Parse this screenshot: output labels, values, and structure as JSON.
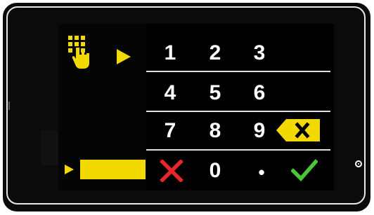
{
  "icons": {
    "keypad": "keypad-hand-icon",
    "pointer_top": "play-arrow-icon",
    "pointer_entry": "play-arrow-icon",
    "backspace": "backspace-icon",
    "cancel": "cross-icon",
    "confirm": "checkmark-icon"
  },
  "keypad": {
    "row1": [
      "1",
      "2",
      "3"
    ],
    "row2": [
      "4",
      "5",
      "6"
    ],
    "row3": [
      "7",
      "8",
      "9"
    ],
    "row4": {
      "zero": "0",
      "dot": "•"
    }
  },
  "colors": {
    "accent": "#f2d900",
    "cancel": "#e8262a",
    "confirm": "#4cc53a",
    "screen": "#000000",
    "text": "#ffffff"
  },
  "entry_field": {
    "value": ""
  }
}
